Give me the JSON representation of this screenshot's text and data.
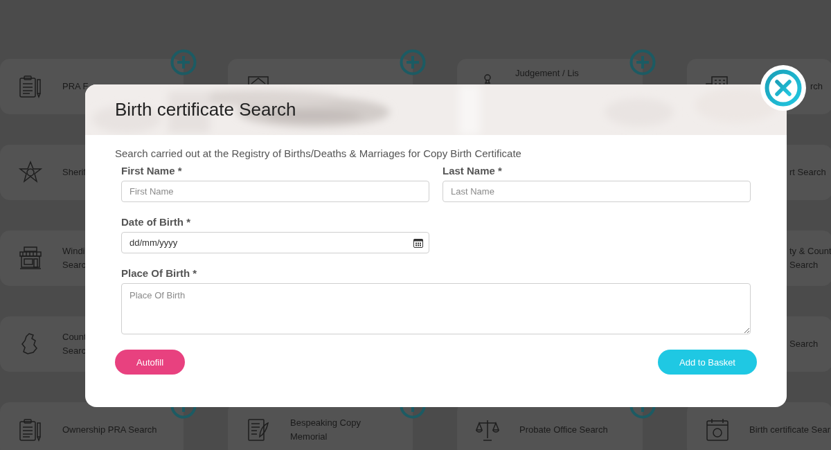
{
  "tile_rows": [
    {
      "tiles": [
        {
          "lines": [
            "PRA F"
          ],
          "kind": "full",
          "plus": true
        },
        {
          "plus": true
        },
        {
          "lines": [
            "Judgement / Lis"
          ],
          "kind": "top_line",
          "plus": true
        },
        {
          "lines": [
            "rch"
          ],
          "kind": "tail_end",
          "plus": false
        }
      ]
    },
    {
      "tiles": [
        {
          "lines": [
            "Sherif"
          ],
          "kind": "full",
          "plus": false
        },
        {
          "lines": [
            "rt Search"
          ],
          "kind": "tail",
          "plus": false
        }
      ]
    },
    {
      "tiles": [
        {
          "lines": [
            "Windi",
            "Searc"
          ],
          "kind": "full",
          "plus": false
        },
        {
          "lines": [
            "ty & Count",
            "Search"
          ],
          "kind": "tail",
          "plus": false
        }
      ]
    },
    {
      "tiles": [
        {
          "lines": [
            "Count",
            "Searc"
          ],
          "kind": "full",
          "plus": false
        },
        {
          "lines": [
            "Search"
          ],
          "kind": "tail",
          "plus": false
        }
      ]
    },
    {
      "tiles": [
        {
          "lines": [
            "Ownership PRA Search"
          ],
          "kind": "full",
          "plus": true
        },
        {
          "lines": [
            "Bespeaking Copy",
            "Memorial"
          ],
          "kind": "full",
          "plus": true
        },
        {
          "lines": [
            "Probate Office Search"
          ],
          "kind": "full",
          "plus": true
        },
        {
          "lines": [
            "Birth certificate Sear"
          ],
          "kind": "full",
          "plus": false
        }
      ]
    }
  ],
  "dialog": {
    "title": "Birth certificate Search",
    "description": "Search carried out at the Registry of Births/Deaths & Marriages for Copy Birth Certificate",
    "fields": [
      {
        "label": "First Name *",
        "placeholder": "First Name",
        "kind": "text"
      },
      {
        "label": "Last Name *",
        "placeholder": "Last Name",
        "kind": "text"
      },
      {
        "label": "Date of Birth *",
        "placeholder": "dd/mm/yyyy",
        "kind": "date"
      },
      {
        "label": "Place Of Birth *",
        "placeholder": "Place Of Birth",
        "kind": "textarea"
      }
    ],
    "buttons": [
      {
        "label": "Autofill",
        "kind": "secondary"
      },
      {
        "label": "Add to Basket",
        "kind": "primary"
      }
    ]
  }
}
